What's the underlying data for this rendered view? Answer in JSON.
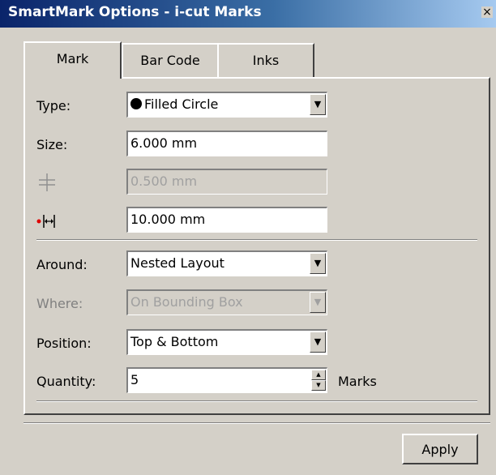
{
  "window": {
    "title": "SmartMark Options - i-cut Marks",
    "close_glyph": "×"
  },
  "tabs": [
    {
      "label": "Mark",
      "active": true
    },
    {
      "label": "Bar Code",
      "active": false
    },
    {
      "label": "Inks",
      "active": false
    }
  ],
  "form": {
    "type": {
      "label": "Type:",
      "value": "Filled Circle",
      "icon": "filled-circle-icon"
    },
    "size": {
      "label": "Size:",
      "value": "6.000 mm"
    },
    "line_offset": {
      "icon": "crosshair-offset-icon",
      "value": "0.500 mm",
      "disabled": true
    },
    "mark_distance": {
      "icon": "horizontal-distance-icon",
      "value": "10.000 mm"
    },
    "around": {
      "label": "Around:",
      "value": "Nested Layout"
    },
    "where": {
      "label": "Where:",
      "value": "On Bounding Box",
      "disabled": true
    },
    "position": {
      "label": "Position:",
      "value": "Top & Bottom"
    },
    "quantity": {
      "label": "Quantity:",
      "value": "5",
      "unit": "Marks"
    }
  },
  "buttons": {
    "apply": "Apply"
  },
  "colors": {
    "titlebar_start": "#0a246a",
    "titlebar_end": "#a6caf0",
    "face": "#d4d0c8",
    "marker_red": "#e00000"
  }
}
